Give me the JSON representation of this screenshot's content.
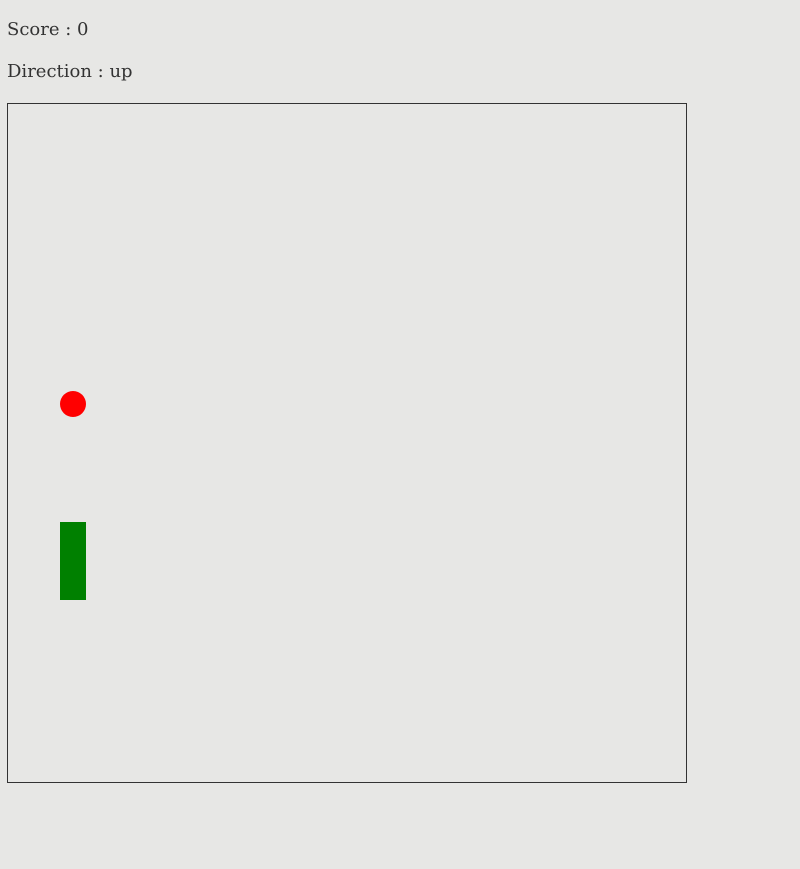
{
  "hud": {
    "score_label": "Score : ",
    "score_value": "0",
    "direction_label": "Direction : ",
    "direction_value": "up"
  },
  "game": {
    "food_color": "#ff0000",
    "snake_color": "#008000",
    "board_border_color": "#333333",
    "background_color": "#e7e7e5"
  }
}
